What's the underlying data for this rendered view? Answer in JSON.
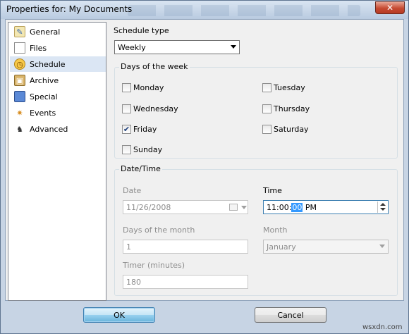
{
  "window": {
    "title": "Properties for: My Documents"
  },
  "nav": {
    "items": [
      {
        "label": "General",
        "icon": "general-icon"
      },
      {
        "label": "Files",
        "icon": "files-icon"
      },
      {
        "label": "Schedule",
        "icon": "schedule-icon",
        "active": true
      },
      {
        "label": "Archive",
        "icon": "archive-icon"
      },
      {
        "label": "Special",
        "icon": "special-icon"
      },
      {
        "label": "Events",
        "icon": "events-icon"
      },
      {
        "label": "Advanced",
        "icon": "advanced-icon"
      }
    ]
  },
  "schedule": {
    "type_label": "Schedule type",
    "type_value": "Weekly"
  },
  "days": {
    "title": "Days of the week",
    "monday": "Monday",
    "tuesday": "Tuesday",
    "wednesday": "Wednesday",
    "thursday": "Thursday",
    "friday": "Friday",
    "saturday": "Saturday",
    "sunday": "Sunday",
    "checked": [
      "Friday"
    ]
  },
  "datetime": {
    "title": "Date/Time",
    "date_label": "Date",
    "date_value": "11/26/2008",
    "time_label": "Time",
    "time_prefix": "11:00:",
    "time_selected": "00",
    "time_suffix": " PM",
    "days_of_month_label": "Days of the month",
    "days_of_month_value": "1",
    "month_label": "Month",
    "month_value": "January",
    "timer_label": "Timer (minutes)",
    "timer_value": "180"
  },
  "buttons": {
    "ok": "OK",
    "cancel": "Cancel"
  },
  "watermark": "wsxdn.com",
  "colors": {
    "active_nav": "#dbe6f4",
    "ok_border": "#3c7fb1",
    "close_red": "#c64a32",
    "selection": "#3399ff"
  }
}
